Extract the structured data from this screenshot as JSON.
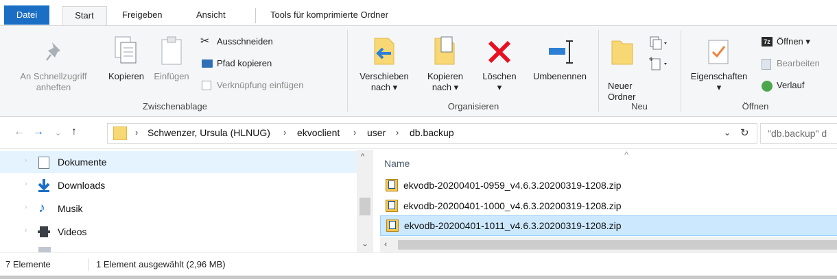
{
  "ribbon_tabs": {
    "file": "Datei",
    "start": "Start",
    "share": "Freigeben",
    "view": "Ansicht",
    "tools": "Tools für komprimierte Ordner"
  },
  "clipboard": {
    "pin_line1": "An Schnellzugriff",
    "pin_line2": "anheften",
    "copy": "Kopieren",
    "paste": "Einfügen",
    "cut": "Ausschneiden",
    "copy_path": "Pfad kopieren",
    "paste_shortcut": "Verknüpfung einfügen",
    "group_label": "Zwischenablage"
  },
  "organize": {
    "move_line1": "Verschieben",
    "move_line2": "nach ▾",
    "copy_line1": "Kopieren",
    "copy_line2": "nach ▾",
    "delete": "Löschen",
    "delete_arrow": "▾",
    "rename": "Umbenennen",
    "group_label": "Organisieren"
  },
  "new": {
    "folder_line1": "Neuer",
    "folder_line2": "Ordner",
    "group_label": "Neu"
  },
  "open": {
    "properties": "Eigenschaften",
    "properties_arrow": "▾",
    "open": "Öffnen ▾",
    "edit": "Bearbeiten",
    "history": "Verlauf",
    "group_label": "Öffnen"
  },
  "address": {
    "crumbs": [
      "Schwenzer, Ursula (HLNUG)",
      "ekvoclient",
      "user",
      "db.backup"
    ],
    "search_placeholder": "\"db.backup\" d"
  },
  "nav_pane": {
    "items": [
      {
        "label": "Dokumente"
      },
      {
        "label": "Downloads"
      },
      {
        "label": "Musik"
      },
      {
        "label": "Videos"
      }
    ]
  },
  "file_list": {
    "column_name": "Name",
    "files": [
      {
        "name": "ekvodb-20200401-0959_v4.6.3.20200319-1208.zip"
      },
      {
        "name": "ekvodb-20200401-1000_v4.6.3.20200319-1208.zip"
      },
      {
        "name": "ekvodb-20200401-1011_v4.6.3.20200319-1208.zip"
      }
    ]
  },
  "status": {
    "count": "7 Elemente",
    "selection": "1 Element ausgewählt (2,96 MB)"
  },
  "colors": {
    "accent": "#1a6fc4",
    "selection": "#cce8ff",
    "nav_selection": "#e5f3ff",
    "delete_red": "#e81123"
  }
}
